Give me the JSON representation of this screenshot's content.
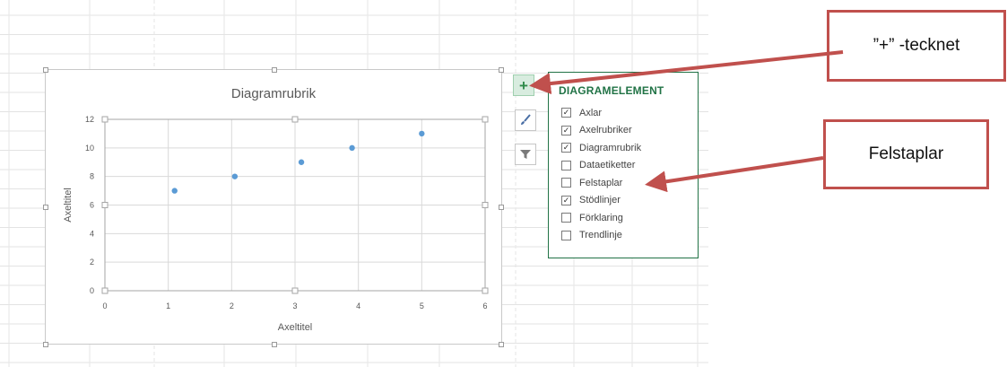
{
  "chart": {
    "title": "Diagramrubrik",
    "xlabel": "Axeltitel",
    "ylabel": "Axeltitel"
  },
  "chart_data": {
    "type": "scatter",
    "title": "Diagramrubrik",
    "xlabel": "Axeltitel",
    "ylabel": "Axeltitel",
    "xlim": [
      0,
      6
    ],
    "ylim": [
      0,
      12
    ],
    "xticks": [
      0,
      1,
      2,
      3,
      4,
      5,
      6
    ],
    "yticks": [
      0,
      2,
      4,
      6,
      8,
      10,
      12
    ],
    "grid": true,
    "series": [
      {
        "x": [
          1.1,
          2.05,
          3.1,
          3.9,
          5.0
        ],
        "y": [
          7,
          8,
          9,
          10,
          11
        ],
        "color": "#5b9bd5"
      }
    ]
  },
  "side_buttons": [
    {
      "icon": "plus-icon",
      "state": "active"
    },
    {
      "icon": "paintbrush-icon"
    },
    {
      "icon": "filter-icon"
    }
  ],
  "panel": {
    "title": "DIAGRAMELEMENT",
    "items": [
      {
        "label": "Axlar",
        "checked": true
      },
      {
        "label": "Axelrubriker",
        "checked": true
      },
      {
        "label": "Diagramrubrik",
        "checked": true
      },
      {
        "label": "Dataetiketter",
        "checked": false
      },
      {
        "label": "Felstaplar",
        "checked": false
      },
      {
        "label": "Stödlinjer",
        "checked": true
      },
      {
        "label": "Förklaring",
        "checked": false
      },
      {
        "label": "Trendlinje",
        "checked": false
      }
    ]
  },
  "callouts": {
    "plus": "”+” -tecknet",
    "felstaplar": "Felstaplar"
  },
  "colors": {
    "accent": "#217346",
    "callout": "#c0504d",
    "marker": "#5b9bd5"
  }
}
